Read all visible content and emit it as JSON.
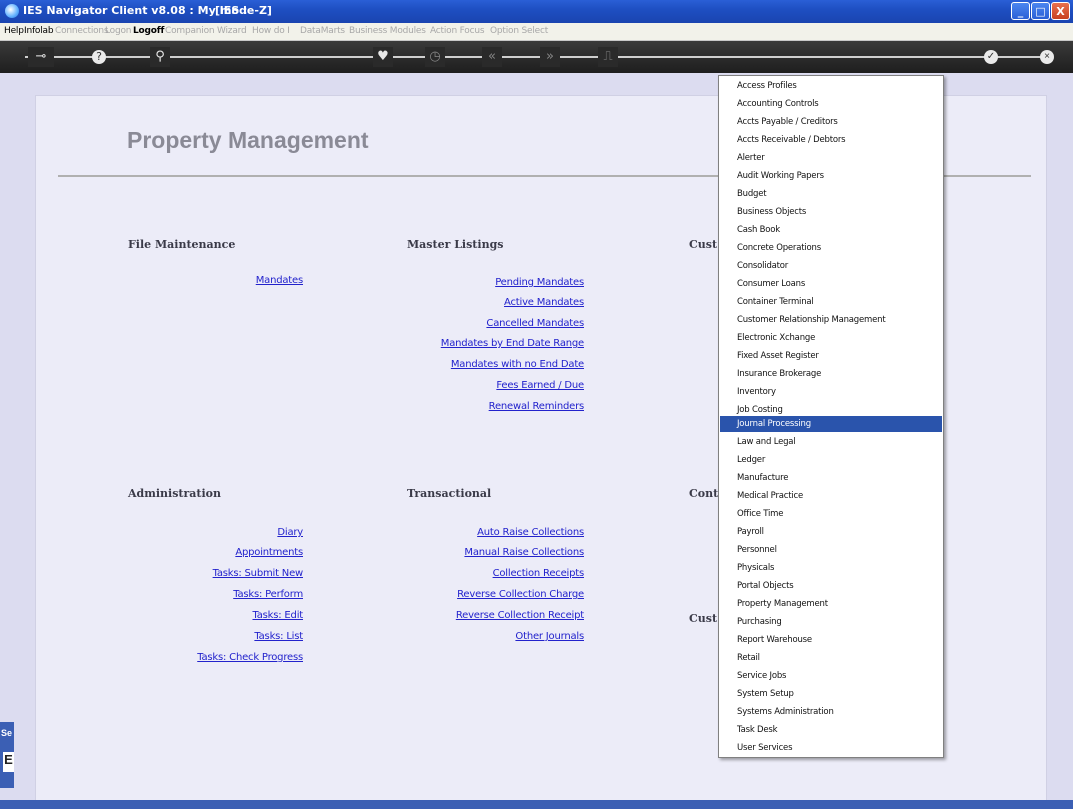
{
  "window": {
    "title": "IES Navigator Client v8.08 : My IES :",
    "mode": "[mode-Z]",
    "minimize": "_",
    "maximize": "□",
    "close": "X"
  },
  "menubar": {
    "items": [
      "Help",
      "Infolab",
      "Connections",
      "Logon",
      "Logoff",
      "Companion",
      "Wizard",
      "How do I",
      "DataMarts",
      "Business Modules",
      "Action Focus",
      "Option Select"
    ]
  },
  "toolbar": {
    "icons": [
      "key-icon",
      "help-icon",
      "search-icon",
      "heart-icon",
      "clock-icon",
      "back-icon",
      "forward-icon",
      "page-icon",
      "check-icon",
      "close-icon"
    ]
  },
  "page": {
    "title": "Property Management"
  },
  "sections": {
    "file_maintenance": {
      "heading": "File Maintenance",
      "links": [
        "Mandates"
      ]
    },
    "master_listings": {
      "heading": "Master Listings",
      "links": [
        "Pending Mandates",
        "Active Mandates",
        "Cancelled Mandates",
        "Mandates by End Date Range",
        "Mandates with no End Date",
        "Fees Earned / Due",
        "Renewal Reminders"
      ]
    },
    "cust_top": {
      "heading": "Cust"
    },
    "administration": {
      "heading": "Administration",
      "links": [
        "Diary",
        "Appointments",
        "Tasks: Submit New",
        "Tasks: Perform",
        "Tasks: Edit",
        "Tasks: List",
        "Tasks: Check Progress"
      ]
    },
    "transactional": {
      "heading": "Transactional",
      "links": [
        "Auto Raise Collections",
        "Manual Raise Collections",
        "Collection Receipts",
        "Reverse Collection Charge",
        "Reverse Collection Receipt",
        "Other Journals"
      ]
    },
    "cont": {
      "heading": "Cont"
    },
    "cust_bottom": {
      "heading": "Cust"
    }
  },
  "left_strip": {
    "label": "Se",
    "letter": "E"
  },
  "dropdown": {
    "selected": "Journal Processing",
    "items": [
      "Access Profiles",
      "Accounting Controls",
      "Accts Payable / Creditors",
      "Accts Receivable / Debtors",
      "Alerter",
      "Audit Working Papers",
      "Budget",
      "Business Objects",
      "Cash Book",
      "Concrete Operations",
      "Consolidator",
      "Consumer Loans",
      "Container Terminal",
      "Customer Relationship Management",
      "Electronic Xchange",
      "Fixed Asset Register",
      "Insurance Brokerage",
      "Inventory",
      "Job Costing",
      "Journal Processing",
      "Law and Legal",
      "Ledger",
      "Manufacture",
      "Medical Practice",
      "Office Time",
      "Payroll",
      "Personnel",
      "Physicals",
      "Portal Objects",
      "Property Management",
      "Purchasing",
      "Report Warehouse",
      "Retail",
      "Service Jobs",
      "System Setup",
      "Systems Administration",
      "Task Desk",
      "User Services"
    ]
  }
}
